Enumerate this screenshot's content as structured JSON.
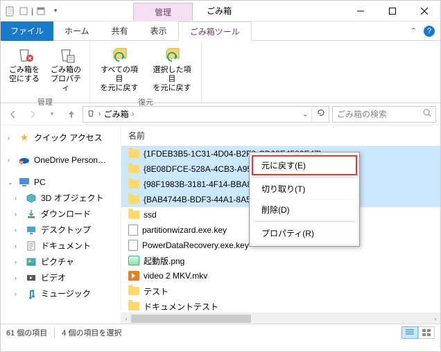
{
  "title": {
    "context_tab": "管理",
    "app_title": "ごみ箱"
  },
  "ribbon": {
    "file_tab": "ファイル",
    "tabs": [
      "ホーム",
      "共有",
      "表示"
    ],
    "context_tab": "ごみ箱ツール",
    "groups": [
      {
        "label": "管理",
        "items": [
          {
            "label": "ごみ箱を\n空にする",
            "icon": "recycle-empty-icon"
          },
          {
            "label": "ごみ箱の\nプロパティ",
            "icon": "recycle-props-icon"
          }
        ]
      },
      {
        "label": "復元",
        "items": [
          {
            "label": "すべての項目\nを元に戻す",
            "icon": "restore-all-icon"
          },
          {
            "label": "選択した項目\nを元に戻す",
            "icon": "restore-selected-icon"
          }
        ]
      }
    ]
  },
  "address": {
    "path": [
      "ごみ箱"
    ],
    "search_placeholder": "ごみ箱の検索"
  },
  "nav": {
    "quick_access": "クイック アクセス",
    "onedrive": "OneDrive  Person…",
    "pc": "PC",
    "pc_children": [
      {
        "label": "3D オブジェクト",
        "icon": "cube-icon"
      },
      {
        "label": "ダウンロード",
        "icon": "download-icon"
      },
      {
        "label": "デスクトップ",
        "icon": "desktop-icon"
      },
      {
        "label": "ドキュメント",
        "icon": "document-icon"
      },
      {
        "label": "ピクチャ",
        "icon": "picture-icon"
      },
      {
        "label": "ビデオ",
        "icon": "video-icon"
      },
      {
        "label": "ミュージック",
        "icon": "music-icon"
      }
    ]
  },
  "columns": {
    "name": "名前"
  },
  "files": [
    {
      "name": "{1FDEB3B5-1C31-4D04-B2F8-CD08E4582E47}",
      "type": "folder",
      "selected": true
    },
    {
      "name": "{8E08DFCE-528A-4CB3-A95B…",
      "type": "folder",
      "selected": true
    },
    {
      "name": "{98F1983B-3181-4F14-BBA8…",
      "type": "folder",
      "selected": true
    },
    {
      "name": "{BAB4744B-BDF3-44A1-8A5…",
      "type": "folder",
      "selected": true
    },
    {
      "name": "ssd",
      "type": "folder",
      "selected": false
    },
    {
      "name": "partitionwizard.exe.key",
      "type": "file",
      "selected": false
    },
    {
      "name": "PowerDataRecovery.exe.key",
      "type": "file",
      "selected": false
    },
    {
      "name": "起動版.png",
      "type": "image",
      "selected": false
    },
    {
      "name": "video 2 MKV.mkv",
      "type": "video",
      "selected": false
    },
    {
      "name": "テスト",
      "type": "folder",
      "selected": false
    },
    {
      "name": "ドキュメントテスト",
      "type": "folder",
      "selected": false
    }
  ],
  "context_menu": {
    "items": [
      {
        "label": "元に戻す(E)",
        "highlight": true
      },
      {
        "label": "切り取り(T)",
        "sep_before": true
      },
      {
        "label": "削除(D)"
      },
      {
        "label": "プロパティ(R)",
        "sep_before": true
      }
    ]
  },
  "status": {
    "total": "61 個の項目",
    "selected": "4 個の項目を選択"
  }
}
